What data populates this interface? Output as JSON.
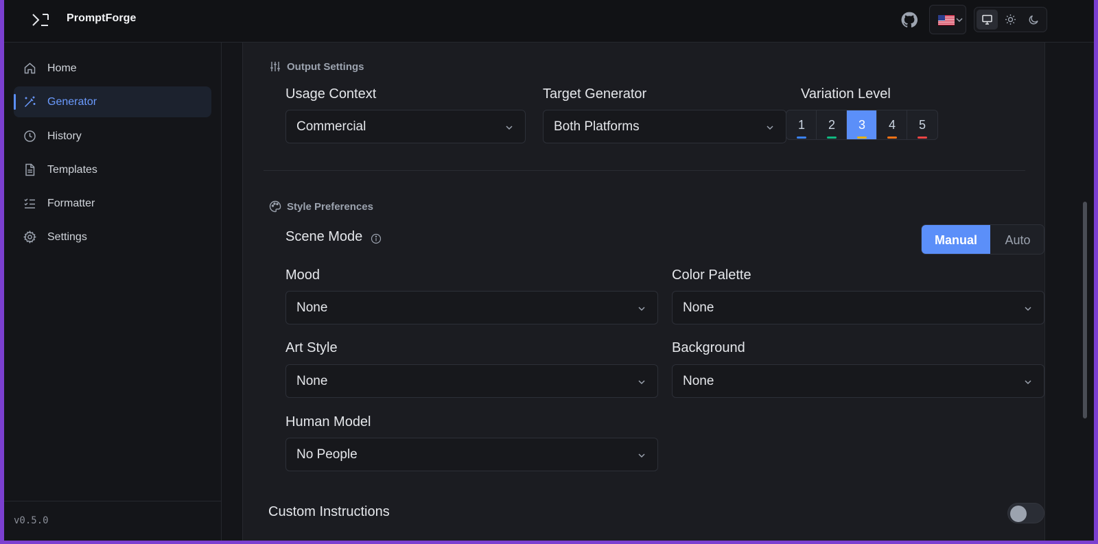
{
  "app": {
    "name": "PromptForge",
    "version": "v0.5.0"
  },
  "header": {
    "github_icon": "github-icon",
    "language": "en-US",
    "theme_options": [
      "system",
      "light",
      "dark"
    ],
    "theme_selected": "system"
  },
  "sidebar": {
    "items": [
      {
        "label": "Home",
        "icon": "home-icon"
      },
      {
        "label": "Generator",
        "icon": "wand-icon",
        "active": true
      },
      {
        "label": "History",
        "icon": "clock-icon"
      },
      {
        "label": "Templates",
        "icon": "document-icon"
      },
      {
        "label": "Formatter",
        "icon": "list-check-icon"
      },
      {
        "label": "Settings",
        "icon": "gear-icon"
      }
    ]
  },
  "output_settings": {
    "title": "Output Settings",
    "usage_context": {
      "label": "Usage Context",
      "value": "Commercial"
    },
    "target_generator": {
      "label": "Target Generator",
      "value": "Both Platforms"
    },
    "variation_level": {
      "label": "Variation Level",
      "options": [
        "1",
        "2",
        "3",
        "4",
        "5"
      ],
      "selected": "3",
      "colors": [
        "#3b82f6",
        "#10b981",
        "#eab308",
        "#f97316",
        "#ef4444"
      ]
    }
  },
  "style_preferences": {
    "title": "Style Preferences",
    "scene_mode": {
      "label": "Scene Mode",
      "options": [
        "Manual",
        "Auto"
      ],
      "selected": "Manual"
    },
    "mood": {
      "label": "Mood",
      "value": "None"
    },
    "color_palette": {
      "label": "Color Palette",
      "value": "None"
    },
    "art_style": {
      "label": "Art Style",
      "value": "None"
    },
    "background": {
      "label": "Background",
      "value": "None"
    },
    "human_model": {
      "label": "Human Model",
      "value": "No People"
    }
  },
  "custom_instructions": {
    "label": "Custom Instructions",
    "enabled": false
  },
  "colors": {
    "accent": "#5b8ff9",
    "background": "#141519",
    "panel": "#1b1c21"
  }
}
